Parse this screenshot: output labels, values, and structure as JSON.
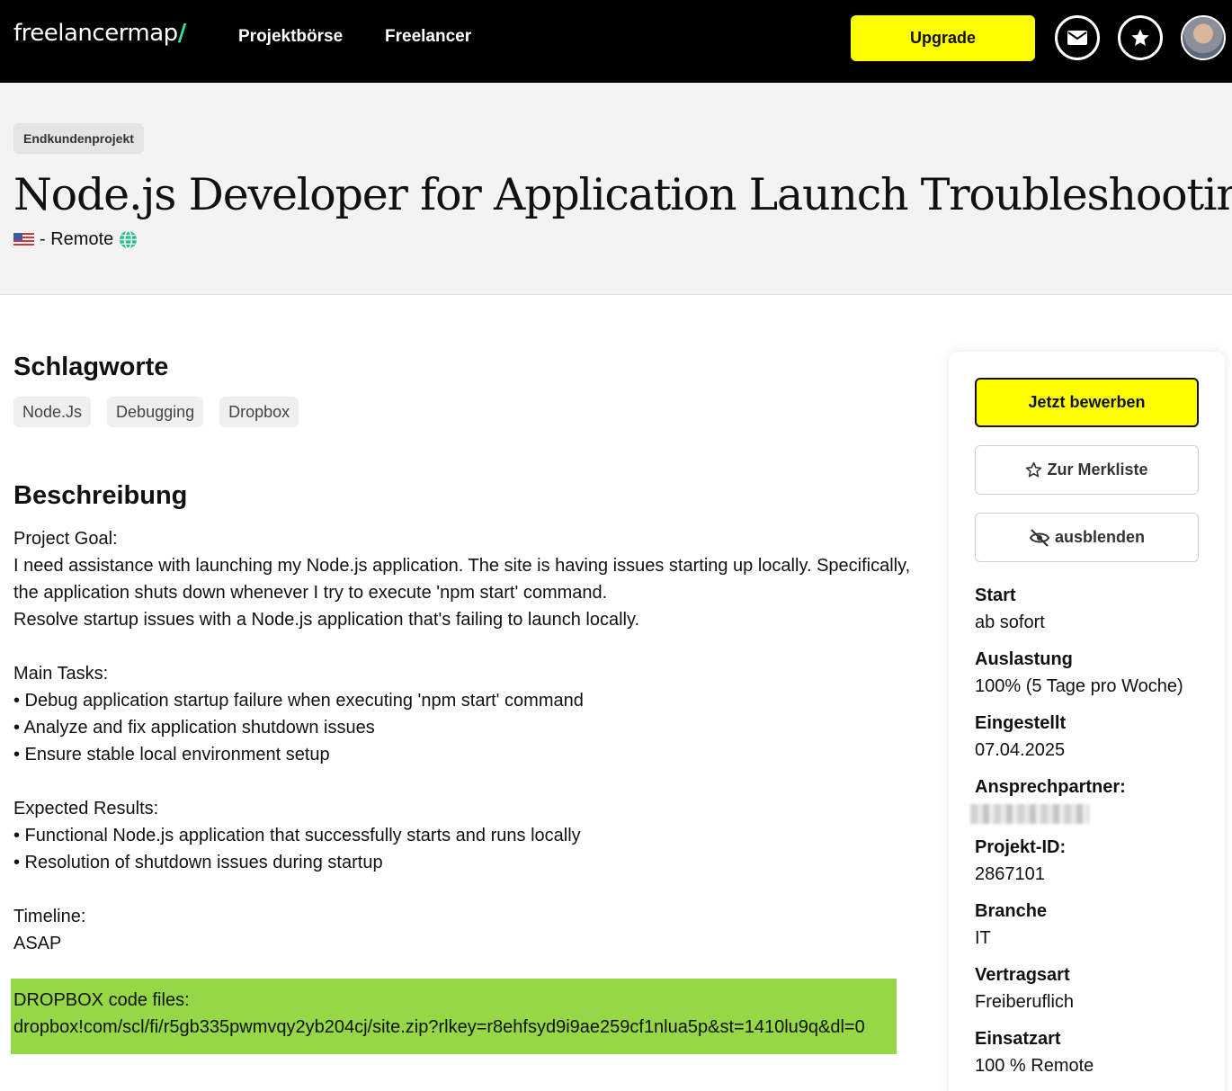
{
  "nav": {
    "logo_text": "freelancermap",
    "logo_slash": "/",
    "links": [
      "Projektbörse",
      "Freelancer"
    ],
    "upgrade_label": "Upgrade",
    "icons": [
      "mail-icon",
      "star-icon",
      "avatar"
    ]
  },
  "header": {
    "badge": "Endkundenprojekt",
    "title": "Node.js Developer for Application Launch Troubleshooting",
    "location": "- Remote",
    "flag_icon": "us-flag-icon",
    "globe_icon": "globe-icon"
  },
  "keywords": {
    "heading": "Schlagworte",
    "tags": [
      "Node.Js",
      "Debugging",
      "Dropbox"
    ]
  },
  "description": {
    "heading": "Beschreibung",
    "lines": [
      "Project Goal:",
      "I need assistance with launching my Node.js application. The site is having issues starting up locally. Specifically, the application shuts down whenever I try to execute 'npm start' command.",
      "Resolve startup issues with a Node.js application that's failing to launch locally.",
      "",
      "Main Tasks:",
      "• Debug application startup failure when executing 'npm start' command",
      "• Analyze and fix application shutdown issues",
      "• Ensure stable local environment setup",
      "",
      "Expected Results:",
      "• Functional Node.js application that successfully starts and runs locally",
      "• Resolution of shutdown issues during startup",
      "",
      "Timeline:",
      "ASAP"
    ],
    "highlight_line1": "DROPBOX code files:",
    "highlight_line2": "dropbox!com/scl/fi/r5gb335pwmvqy2yb204cj/site.zip?rlkey=r8ehfsyd9i9ae259cf1nlua5p&st=1410lu9q&dl=0",
    "highlight_color": "#95d744"
  },
  "sidebar": {
    "apply_label": "Jetzt bewerben",
    "merkliste_label": "Zur Merkliste",
    "hide_label": "ausblenden",
    "facts": [
      {
        "label": "Start",
        "value": "ab sofort"
      },
      {
        "label": "Auslastung",
        "value": "100% (5 Tage pro Woche)"
      },
      {
        "label": "Eingestellt",
        "value": "07.04.2025"
      },
      {
        "label": "Ansprechpartner:",
        "value": ""
      },
      {
        "label": "Projekt-ID:",
        "value": "2867101"
      },
      {
        "label": "Branche",
        "value": "IT"
      },
      {
        "label": "Vertragsart",
        "value": "Freiberuflich"
      },
      {
        "label": "Einsatzart",
        "value": "100 % Remote"
      }
    ]
  },
  "colors": {
    "accent_yellow": "#ffff00",
    "topbar": "#000000",
    "logo_slash": "#2fe0b0",
    "globe": "#2bbf8a"
  }
}
